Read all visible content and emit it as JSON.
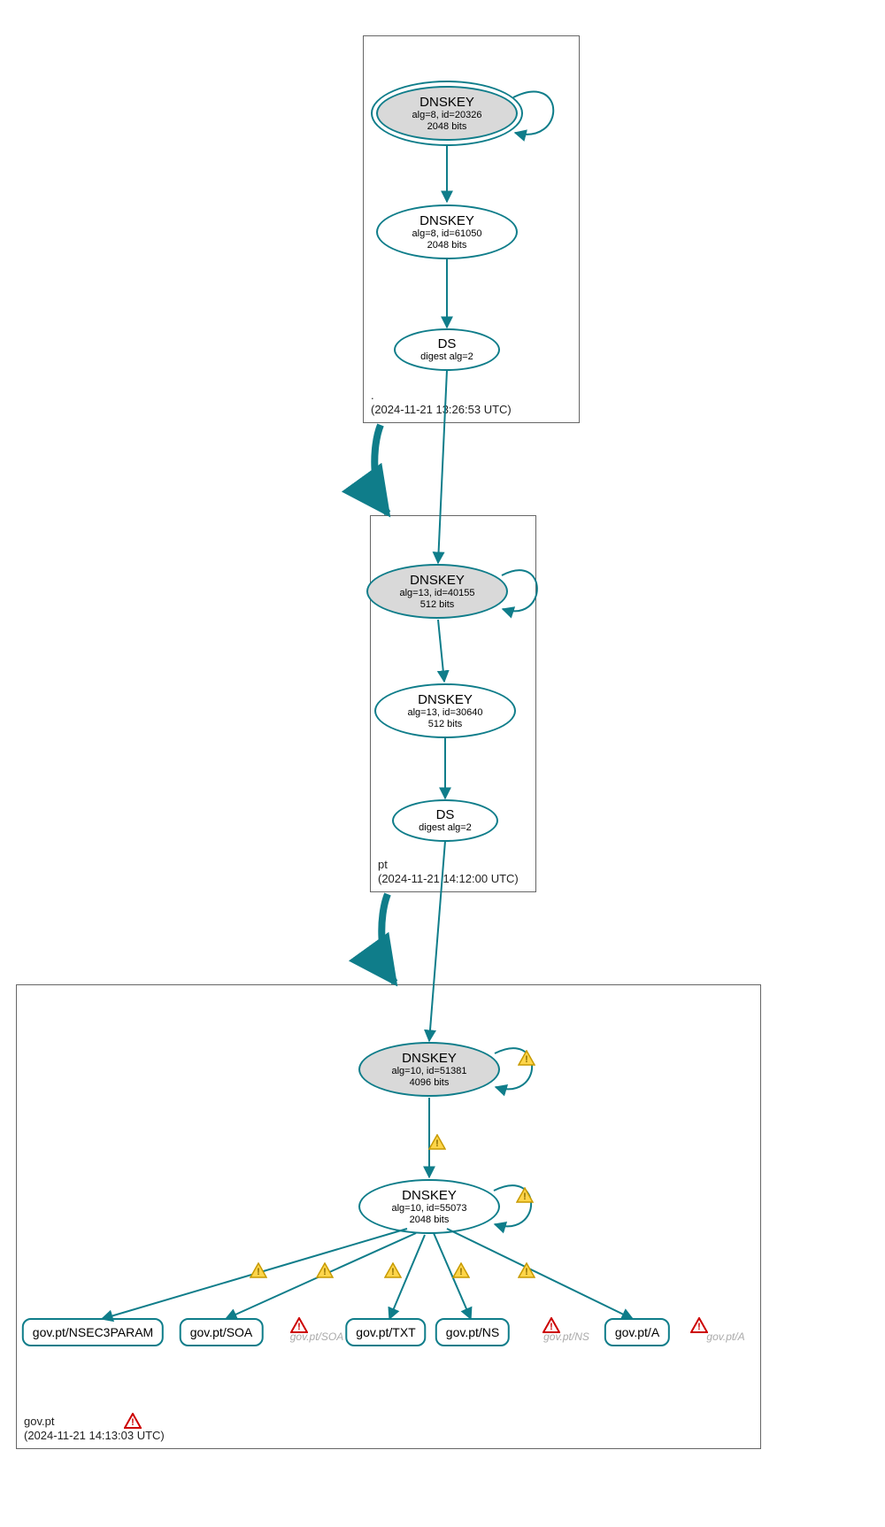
{
  "colors": {
    "stroke": "#0f7d8a",
    "fill_grey": "#d9d9d9"
  },
  "zones": {
    "root": {
      "name": ".",
      "timestamp": "(2024-11-21 13:26:53 UTC)"
    },
    "pt": {
      "name": "pt",
      "timestamp": "(2024-11-21 14:12:00 UTC)"
    },
    "govpt": {
      "name": "gov.pt",
      "timestamp": "(2024-11-21 14:13:03 UTC)"
    }
  },
  "nodes": {
    "root_ksk": {
      "title": "DNSKEY",
      "sub": "alg=8, id=20326",
      "bits": "2048 bits"
    },
    "root_zsk": {
      "title": "DNSKEY",
      "sub": "alg=8, id=61050",
      "bits": "2048 bits"
    },
    "root_ds": {
      "title": "DS",
      "sub": "digest alg=2"
    },
    "pt_ksk": {
      "title": "DNSKEY",
      "sub": "alg=13, id=40155",
      "bits": "512 bits"
    },
    "pt_zsk": {
      "title": "DNSKEY",
      "sub": "alg=13, id=30640",
      "bits": "512 bits"
    },
    "pt_ds": {
      "title": "DS",
      "sub": "digest alg=2"
    },
    "gov_ksk": {
      "title": "DNSKEY",
      "sub": "alg=10, id=51381",
      "bits": "4096 bits"
    },
    "gov_zsk": {
      "title": "DNSKEY",
      "sub": "alg=10, id=55073",
      "bits": "2048 bits"
    }
  },
  "rrsets": {
    "nsec3param": "gov.pt/NSEC3PARAM",
    "soa": "gov.pt/SOA",
    "txt": "gov.pt/TXT",
    "ns": "gov.pt/NS",
    "a": "gov.pt/A"
  },
  "ghosts": {
    "soa": "gov.pt/SOA",
    "ns": "gov.pt/NS",
    "a": "gov.pt/A"
  }
}
